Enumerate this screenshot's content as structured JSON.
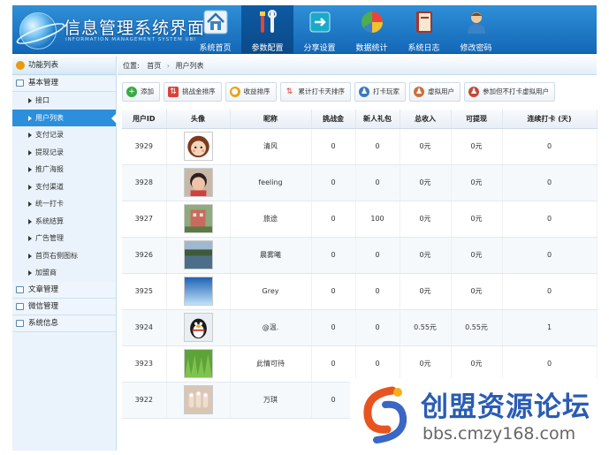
{
  "header": {
    "title": "信息管理系统界面",
    "subtitle": "INFORMATION MANAGEMENT SYSTEM UBI",
    "nav": [
      {
        "label": "系统首页",
        "icon": "home-icon"
      },
      {
        "label": "参数配置",
        "icon": "tools-icon"
      },
      {
        "label": "分享设置",
        "icon": "share-icon"
      },
      {
        "label": "数据统计",
        "icon": "pie-chart-icon"
      },
      {
        "label": "系统日志",
        "icon": "book-icon"
      },
      {
        "label": "修改密码",
        "icon": "user-icon"
      }
    ],
    "active_nav": "参数配置"
  },
  "sidebar": {
    "header": "功能列表",
    "groups": [
      {
        "label": "基本管理",
        "items": [
          "接口",
          "用户列表",
          "支付记录",
          "提现记录",
          "推广海报",
          "支付渠道",
          "统一打卡",
          "系统结算",
          "广告管理",
          "首页右侧图标",
          "加盟商"
        ]
      },
      {
        "label": "文章管理"
      },
      {
        "label": "微信管理"
      },
      {
        "label": "系统信息"
      }
    ],
    "active_item": "用户列表"
  },
  "breadcrumb": {
    "prefix": "位置:",
    "home": "首页",
    "current": "用户列表"
  },
  "toolbar": [
    {
      "label": "添加",
      "icon": "plus-icon",
      "color": "#3aa845"
    },
    {
      "label": "挑战金排序",
      "icon": "sort-icon",
      "color": "#d9433a"
    },
    {
      "label": "收益排序",
      "icon": "coin-icon",
      "color": "#e8a317"
    },
    {
      "label": "累计打卡天排序",
      "icon": "sort-arrows-icon",
      "color": "#d9433a"
    },
    {
      "label": "打卡玩家",
      "icon": "users-icon",
      "color": "#3b78c2"
    },
    {
      "label": "虚拟用户",
      "icon": "virtual-user-icon",
      "color": "#c9713a"
    },
    {
      "label": "参加但不打卡虚拟用户",
      "icon": "user-alert-icon",
      "color": "#c24a3a"
    }
  ],
  "table": {
    "columns": [
      "用户ID",
      "头像",
      "昵称",
      "挑战金",
      "新人礼包",
      "总收入",
      "可提现",
      "连续打卡 (天)"
    ],
    "rows": [
      {
        "id": "3929",
        "avatar": "cartoon-girl",
        "name": "清风",
        "challenge": "0",
        "gift": "0",
        "income": "0元",
        "withdraw": "0元",
        "streak": "0"
      },
      {
        "id": "3928",
        "avatar": "child-photo",
        "name": "feeling",
        "challenge": "0",
        "gift": "0",
        "income": "0元",
        "withdraw": "0元",
        "streak": "0"
      },
      {
        "id": "3927",
        "avatar": "building-photo",
        "name": "旅途",
        "challenge": "0",
        "gift": "100",
        "income": "0元",
        "withdraw": "0元",
        "streak": "0"
      },
      {
        "id": "3926",
        "avatar": "lake-photo",
        "name": "晨雾曦",
        "challenge": "0",
        "gift": "0",
        "income": "0元",
        "withdraw": "0元",
        "streak": "0"
      },
      {
        "id": "3925",
        "avatar": "sky-photo",
        "name": "Grey",
        "challenge": "0",
        "gift": "0",
        "income": "0元",
        "withdraw": "0元",
        "streak": "0"
      },
      {
        "id": "3924",
        "avatar": "penguin",
        "name": "@温.",
        "challenge": "0",
        "gift": "0",
        "income": "0.55元",
        "withdraw": "0.55元",
        "streak": "1"
      },
      {
        "id": "3923",
        "avatar": "grass-photo",
        "name": "此情可待",
        "challenge": "0",
        "gift": "0",
        "income": "0元",
        "withdraw": "0元",
        "streak": "0"
      },
      {
        "id": "3922",
        "avatar": "nails-photo",
        "name": "万琪",
        "challenge": "0",
        "gift": "",
        "income": "",
        "withdraw": "",
        "streak": ""
      }
    ]
  },
  "watermark": {
    "title": "创盟资源论坛",
    "url": "bbs.cmzy168.com"
  }
}
